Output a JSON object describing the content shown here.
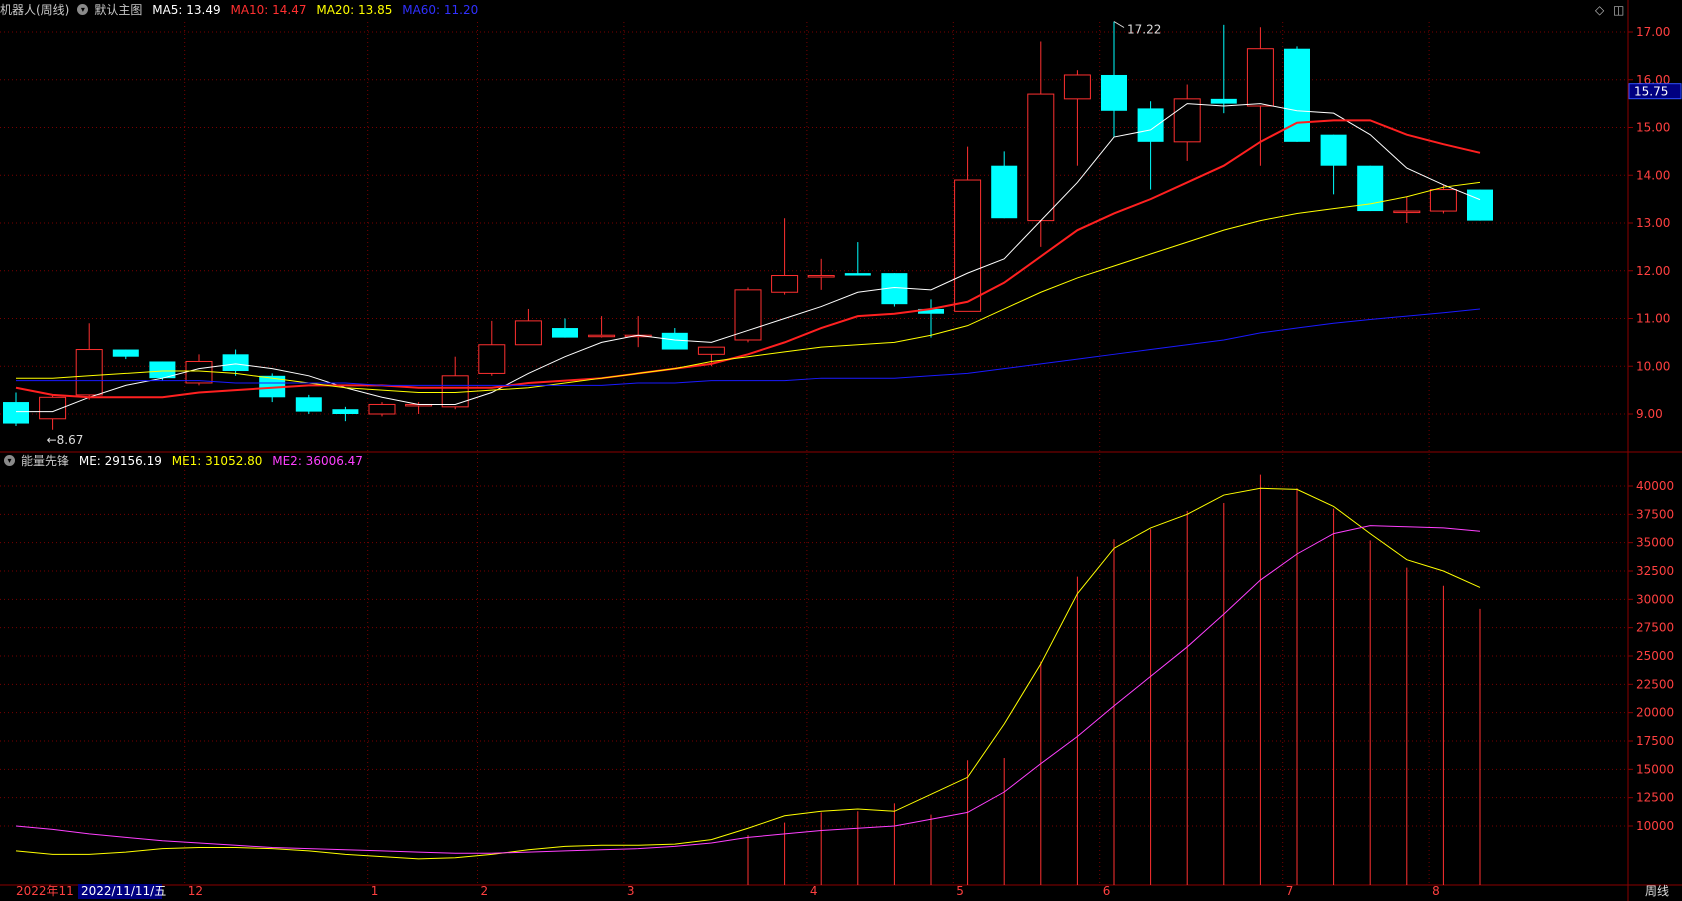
{
  "price_panel": {
    "stock_name": "机器人(周线)",
    "template": "默认主图",
    "legend": [
      {
        "label": "MA5: 13.49",
        "color": "#ffffff"
      },
      {
        "label": "MA10: 14.47",
        "color": "#ff3030"
      },
      {
        "label": "MA20: 13.85",
        "color": "#ffff00"
      },
      {
        "label": "MA60: 11.20",
        "color": "#2b2bff"
      }
    ],
    "current_price": "15.75"
  },
  "volume_panel": {
    "indicator_name": "能量先锋",
    "legend": [
      {
        "label": "ME: 29156.19",
        "color": "#ffffff"
      },
      {
        "label": "ME1: 31052.80",
        "color": "#ffff00"
      },
      {
        "label": "ME2: 36006.47",
        "color": "#ff40ff"
      }
    ]
  },
  "footer": {
    "start_label": "2022年11",
    "cursor_date": "2022/11/11/五",
    "period": "周线"
  },
  "icons": [
    "diamond-icon",
    "window-icon",
    "settings-circle-icon"
  ],
  "chart_data": [
    {
      "type": "candlestick",
      "title": "机器人(周线)",
      "ylim": [
        8.0,
        17.3
      ],
      "y_ticks": [
        "9.00",
        "10.00",
        "11.00",
        "12.00",
        "13.00",
        "14.00",
        "15.00",
        "16.00",
        "17.00"
      ],
      "x_month_labels": [
        {
          "label": "12",
          "week": 5
        },
        {
          "label": "1",
          "week": 10
        },
        {
          "label": "2",
          "week": 13
        },
        {
          "label": "3",
          "week": 17
        },
        {
          "label": "4",
          "week": 22
        },
        {
          "label": "5",
          "week": 26
        },
        {
          "label": "6",
          "week": 30
        },
        {
          "label": "7",
          "week": 35
        },
        {
          "label": "8",
          "week": 39
        }
      ],
      "candles": [
        {
          "o": 9.25,
          "h": 9.45,
          "l": 8.75,
          "c": 8.8
        },
        {
          "o": 8.9,
          "h": 9.4,
          "l": 8.67,
          "c": 9.35
        },
        {
          "o": 9.4,
          "h": 10.9,
          "l": 9.3,
          "c": 10.35
        },
        {
          "o": 10.35,
          "h": 10.35,
          "l": 10.15,
          "c": 10.2
        },
        {
          "o": 10.1,
          "h": 10.1,
          "l": 9.7,
          "c": 9.75
        },
        {
          "o": 9.65,
          "h": 10.25,
          "l": 9.6,
          "c": 10.1
        },
        {
          "o": 10.25,
          "h": 10.35,
          "l": 9.8,
          "c": 9.9
        },
        {
          "o": 9.8,
          "h": 9.85,
          "l": 9.25,
          "c": 9.35
        },
        {
          "o": 9.35,
          "h": 9.4,
          "l": 9.0,
          "c": 9.05
        },
        {
          "o": 9.1,
          "h": 9.15,
          "l": 8.85,
          "c": 9.0
        },
        {
          "o": 9.0,
          "h": 9.25,
          "l": 8.95,
          "c": 9.2
        },
        {
          "o": 9.2,
          "h": 9.25,
          "l": 9.0,
          "c": 9.2
        },
        {
          "o": 9.15,
          "h": 10.2,
          "l": 9.1,
          "c": 9.8
        },
        {
          "o": 9.85,
          "h": 10.95,
          "l": 9.8,
          "c": 10.45
        },
        {
          "o": 10.45,
          "h": 11.2,
          "l": 10.45,
          "c": 10.95
        },
        {
          "o": 10.8,
          "h": 11.0,
          "l": 10.6,
          "c": 10.6
        },
        {
          "o": 10.65,
          "h": 11.05,
          "l": 10.6,
          "c": 10.65
        },
        {
          "o": 10.65,
          "h": 11.05,
          "l": 10.4,
          "c": 10.65
        },
        {
          "o": 10.7,
          "h": 10.8,
          "l": 10.35,
          "c": 10.35
        },
        {
          "o": 10.25,
          "h": 10.4,
          "l": 10.0,
          "c": 10.4
        },
        {
          "o": 10.55,
          "h": 11.65,
          "l": 10.5,
          "c": 11.6
        },
        {
          "o": 11.55,
          "h": 13.1,
          "l": 11.5,
          "c": 11.9
        },
        {
          "o": 11.9,
          "h": 12.25,
          "l": 11.6,
          "c": 11.9
        },
        {
          "o": 11.95,
          "h": 12.6,
          "l": 11.9,
          "c": 11.9
        },
        {
          "o": 11.95,
          "h": 11.95,
          "l": 11.25,
          "c": 11.3
        },
        {
          "o": 11.2,
          "h": 11.4,
          "l": 10.6,
          "c": 11.1
        },
        {
          "o": 11.15,
          "h": 14.6,
          "l": 11.15,
          "c": 13.9
        },
        {
          "o": 14.2,
          "h": 14.5,
          "l": 13.1,
          "c": 13.1
        },
        {
          "o": 13.05,
          "h": 16.8,
          "l": 12.5,
          "c": 15.7
        },
        {
          "o": 15.6,
          "h": 16.2,
          "l": 14.2,
          "c": 16.1
        },
        {
          "o": 16.1,
          "h": 17.22,
          "l": 14.8,
          "c": 15.35
        },
        {
          "o": 15.4,
          "h": 15.55,
          "l": 13.7,
          "c": 14.7
        },
        {
          "o": 14.7,
          "h": 15.9,
          "l": 14.3,
          "c": 15.6
        },
        {
          "o": 15.6,
          "h": 17.15,
          "l": 15.3,
          "c": 15.5
        },
        {
          "o": 15.45,
          "h": 17.1,
          "l": 14.2,
          "c": 16.65
        },
        {
          "o": 16.65,
          "h": 16.7,
          "l": 14.7,
          "c": 14.7
        },
        {
          "o": 14.85,
          "h": 14.85,
          "l": 13.6,
          "c": 14.2
        },
        {
          "o": 14.2,
          "h": 14.2,
          "l": 13.25,
          "c": 13.25
        },
        {
          "o": 13.25,
          "h": 13.55,
          "l": 13.0,
          "c": 13.25
        },
        {
          "o": 13.25,
          "h": 13.8,
          "l": 13.2,
          "c": 13.7
        },
        {
          "o": 13.7,
          "h": 13.7,
          "l": 13.05,
          "c": 13.05
        }
      ],
      "annotations": [
        {
          "text": "17.22",
          "week": 30,
          "value": 17.22
        },
        {
          "text": "8.67",
          "week": 1,
          "value": 8.67
        }
      ],
      "series": [
        {
          "name": "MA5",
          "color": "#ffffff",
          "width": 1,
          "values": [
            9.05,
            9.05,
            9.35,
            9.6,
            9.75,
            9.95,
            10.05,
            9.95,
            9.8,
            9.55,
            9.35,
            9.2,
            9.2,
            9.45,
            9.85,
            10.2,
            10.5,
            10.65,
            10.55,
            10.5,
            10.75,
            11.0,
            11.25,
            11.55,
            11.65,
            11.6,
            11.95,
            12.25,
            13.05,
            13.85,
            14.8,
            14.95,
            15.5,
            15.45,
            15.5,
            15.35,
            15.3,
            14.85,
            14.15,
            13.8,
            13.49
          ]
        },
        {
          "name": "MA10",
          "color": "#ff2020",
          "width": 2,
          "values": [
            9.55,
            9.4,
            9.35,
            9.35,
            9.35,
            9.45,
            9.5,
            9.55,
            9.6,
            9.6,
            9.6,
            9.55,
            9.55,
            9.55,
            9.65,
            9.7,
            9.75,
            9.85,
            9.95,
            10.05,
            10.25,
            10.5,
            10.8,
            11.05,
            11.1,
            11.2,
            11.35,
            11.75,
            12.3,
            12.85,
            13.2,
            13.5,
            13.85,
            14.2,
            14.7,
            15.1,
            15.15,
            15.15,
            14.85,
            14.65,
            14.47
          ]
        },
        {
          "name": "MA20",
          "color": "#ffff00",
          "width": 1,
          "values": [
            9.75,
            9.75,
            9.8,
            9.85,
            9.9,
            9.9,
            9.85,
            9.75,
            9.65,
            9.55,
            9.5,
            9.45,
            9.45,
            9.5,
            9.55,
            9.65,
            9.75,
            9.85,
            9.95,
            10.1,
            10.2,
            10.3,
            10.4,
            10.45,
            10.5,
            10.65,
            10.85,
            11.2,
            11.55,
            11.85,
            12.1,
            12.35,
            12.6,
            12.85,
            13.05,
            13.2,
            13.3,
            13.4,
            13.55,
            13.75,
            13.85
          ]
        },
        {
          "name": "MA60",
          "color": "#1a1aff",
          "width": 1,
          "values": [
            9.7,
            9.7,
            9.7,
            9.7,
            9.7,
            9.7,
            9.65,
            9.65,
            9.65,
            9.65,
            9.6,
            9.6,
            9.6,
            9.6,
            9.6,
            9.6,
            9.6,
            9.65,
            9.65,
            9.7,
            9.7,
            9.7,
            9.75,
            9.75,
            9.75,
            9.8,
            9.85,
            9.95,
            10.05,
            10.15,
            10.25,
            10.35,
            10.45,
            10.55,
            10.7,
            10.8,
            10.9,
            10.98,
            11.05,
            11.12,
            11.2
          ]
        }
      ]
    },
    {
      "type": "bar",
      "title": "能量先锋",
      "ylim": [
        6200,
        41300
      ],
      "y_ticks": [
        "10000",
        "12500",
        "15000",
        "17500",
        "20000",
        "22500",
        "25000",
        "27500",
        "30000",
        "32500",
        "35000",
        "37500",
        "40000"
      ],
      "series": [
        {
          "name": "ME",
          "color": "#ff3030",
          "values": [
            0,
            0,
            0,
            0,
            0,
            0,
            0,
            0,
            0,
            0,
            0,
            0,
            0,
            0,
            0,
            0,
            0,
            0,
            0,
            0,
            9200,
            10300,
            11200,
            11300,
            12000,
            11000,
            15800,
            16000,
            24500,
            32000,
            35300,
            36200,
            37800,
            38500,
            41000,
            39800,
            38000,
            35200,
            32800,
            31200,
            29156
          ]
        },
        {
          "name": "ME1",
          "color": "#ffff00",
          "values": [
            7800,
            7500,
            7500,
            7700,
            8000,
            8100,
            8100,
            8000,
            7800,
            7500,
            7300,
            7100,
            7200,
            7500,
            7900,
            8200,
            8300,
            8300,
            8400,
            8800,
            9800,
            10900,
            11300,
            11500,
            11300,
            12800,
            14300,
            19000,
            24300,
            30500,
            34500,
            36300,
            37500,
            39200,
            39800,
            39700,
            38200,
            35800,
            33500,
            32500,
            31052
          ]
        },
        {
          "name": "ME2",
          "color": "#ff40ff",
          "values": [
            10000,
            9700,
            9300,
            9000,
            8700,
            8500,
            8300,
            8100,
            8000,
            7900,
            7800,
            7700,
            7600,
            7600,
            7700,
            7800,
            7900,
            8000,
            8200,
            8500,
            9000,
            9300,
            9600,
            9800,
            10000,
            10600,
            11200,
            13000,
            15500,
            17900,
            20600,
            23200,
            25800,
            28700,
            31700,
            34000,
            35800,
            36500,
            36400,
            36300,
            36006
          ]
        }
      ]
    }
  ]
}
